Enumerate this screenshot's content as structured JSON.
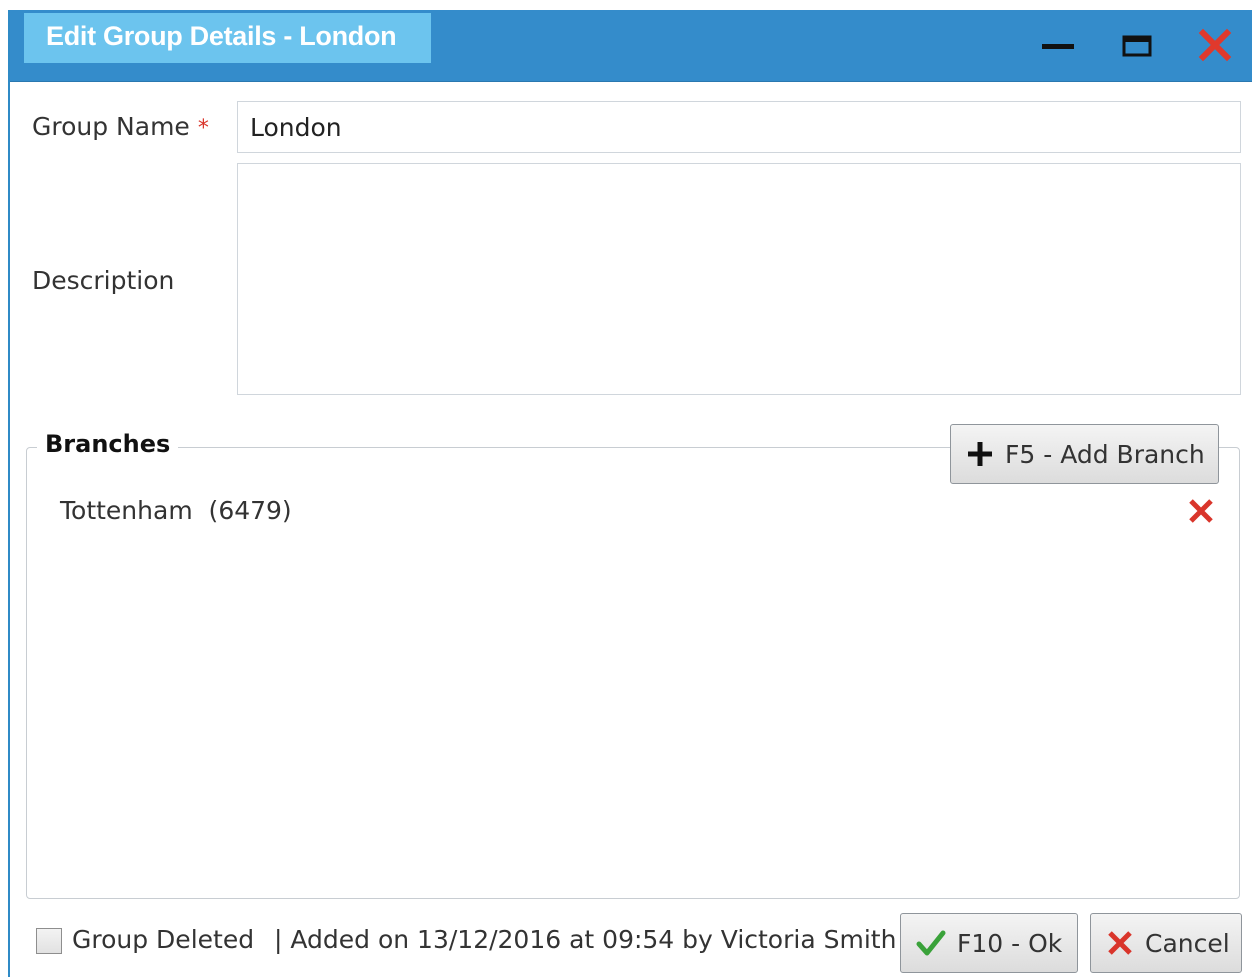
{
  "window": {
    "title": "Edit Group Details - London",
    "controls": {
      "minimize_icon": "minimize-icon",
      "maximize_icon": "maximize-icon",
      "close_icon": "close-icon"
    },
    "colors": {
      "titlebar": "#348ccb",
      "title_tab": "#6cc4ee",
      "close_red": "#d9352b"
    }
  },
  "form": {
    "group_name_label": "Group Name",
    "required_marker": "*",
    "group_name_value": "London",
    "description_label": "Description",
    "description_value": ""
  },
  "branches": {
    "legend": "Branches",
    "add_button_label": "F5 - Add Branch",
    "add_icon": "plus-icon",
    "items": [
      {
        "name": "Tottenham",
        "code": "(6479)",
        "display": "Tottenham  (6479)",
        "remove_icon": "remove-icon"
      }
    ]
  },
  "footer": {
    "group_deleted_label": "Group Deleted",
    "group_deleted_checked": false,
    "audit_text": "| Added on 13/12/2016 at 09:54 by Victoria Smith",
    "ok_button_label": "F10 - Ok",
    "ok_icon": "check-icon",
    "cancel_button_label": "Cancel",
    "cancel_icon": "cancel-x-icon"
  }
}
